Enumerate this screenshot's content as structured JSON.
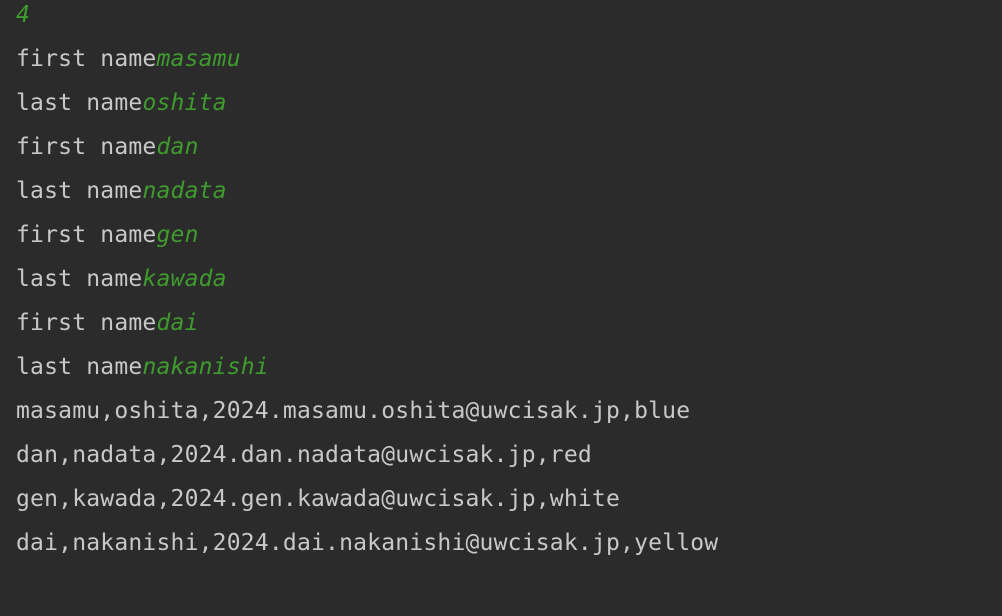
{
  "colors": {
    "background": "#2b2b2b",
    "output_text": "#c8c8c8",
    "user_input": "#3f9b2e"
  },
  "console": {
    "first_input": "4",
    "prompts": [
      {
        "label": "first name",
        "value": "masamu"
      },
      {
        "label": "last name",
        "value": "oshita"
      },
      {
        "label": "first name",
        "value": "dan"
      },
      {
        "label": "last name",
        "value": "nadata"
      },
      {
        "label": "first name",
        "value": "gen"
      },
      {
        "label": "last name",
        "value": "kawada"
      },
      {
        "label": "first name",
        "value": "dai"
      },
      {
        "label": "last name",
        "value": "nakanishi"
      }
    ],
    "output_lines": [
      "masamu,oshita,2024.masamu.oshita@uwcisak.jp,blue",
      "dan,nadata,2024.dan.nadata@uwcisak.jp,red",
      "gen,kawada,2024.gen.kawada@uwcisak.jp,white",
      "dai,nakanishi,2024.dai.nakanishi@uwcisak.jp,yellow"
    ]
  }
}
